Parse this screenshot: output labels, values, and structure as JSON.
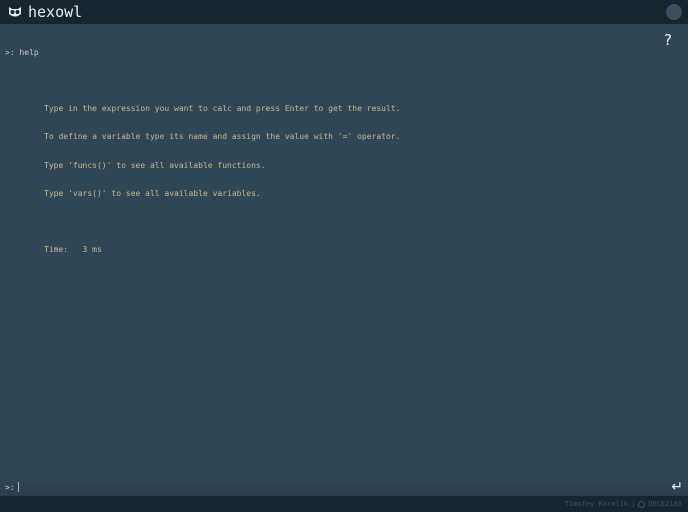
{
  "header": {
    "title": "hexowl"
  },
  "output": {
    "prompt": ">: ",
    "command": "help",
    "lines": [
      "Type in the expression you want to calc and press Enter to get the result.",
      "To define a variable type its name and assign the value with '=' operator.",
      "Type 'funcs()' to see all available functions.",
      "Type 'vars()' to see all available variables."
    ],
    "time_label": "Time:",
    "time_value": "3 ms"
  },
  "help_button": "?",
  "input": {
    "prompt": ">:",
    "value": ""
  },
  "enter_button": "↵",
  "footer": {
    "author": "Timofey Korolik",
    "separator": "|",
    "github_user": "DECE2183"
  }
}
